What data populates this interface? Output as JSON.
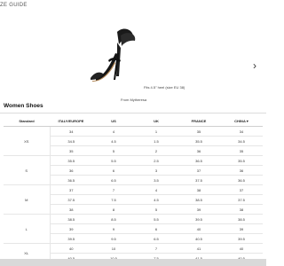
{
  "header": {
    "title": "ZE GUIDE"
  },
  "hero": {
    "fit_note": "Fits 4.5\" heel (size EU 38)",
    "source": "From Mytheresa",
    "product_icon": "heeled-sandal-icon",
    "next_icon": "chevron-right-icon"
  },
  "section": {
    "title": "Women Shoes"
  },
  "table": {
    "headers": [
      "Standard",
      "ITALY/EUROPE",
      "US",
      "UK",
      "FRANCE",
      "CHINA ▾"
    ],
    "groups": [
      {
        "standard": "XS",
        "rows": [
          [
            "34",
            "4",
            "1",
            "35",
            "34"
          ],
          [
            "34.5",
            "4.5",
            "1.5",
            "35.5",
            "34.5"
          ],
          [
            "35",
            "5",
            "2",
            "36",
            "35"
          ]
        ]
      },
      {
        "standard": "S",
        "rows": [
          [
            "35.5",
            "5.5",
            "2.5",
            "36.5",
            "35.5"
          ],
          [
            "36",
            "6",
            "3",
            "37",
            "36"
          ],
          [
            "36.5",
            "6.5",
            "3.5",
            "37.5",
            "36.5"
          ]
        ]
      },
      {
        "standard": "M",
        "rows": [
          [
            "37",
            "7",
            "4",
            "38",
            "37"
          ],
          [
            "37.5",
            "7.5",
            "4.5",
            "38.5",
            "37.5"
          ],
          [
            "38",
            "8",
            "5",
            "39",
            "38"
          ]
        ]
      },
      {
        "standard": "L",
        "rows": [
          [
            "38.5",
            "8.5",
            "5.5",
            "39.5",
            "38.5"
          ],
          [
            "39",
            "9",
            "6",
            "40",
            "39"
          ],
          [
            "39.5",
            "9.5",
            "6.5",
            "40.5",
            "39.5"
          ]
        ]
      },
      {
        "standard": "XL",
        "rows": [
          [
            "40",
            "10",
            "7",
            "41",
            "40"
          ],
          [
            "40.5",
            "10.5",
            "7.5",
            "41.5",
            "40.5"
          ]
        ]
      }
    ]
  }
}
